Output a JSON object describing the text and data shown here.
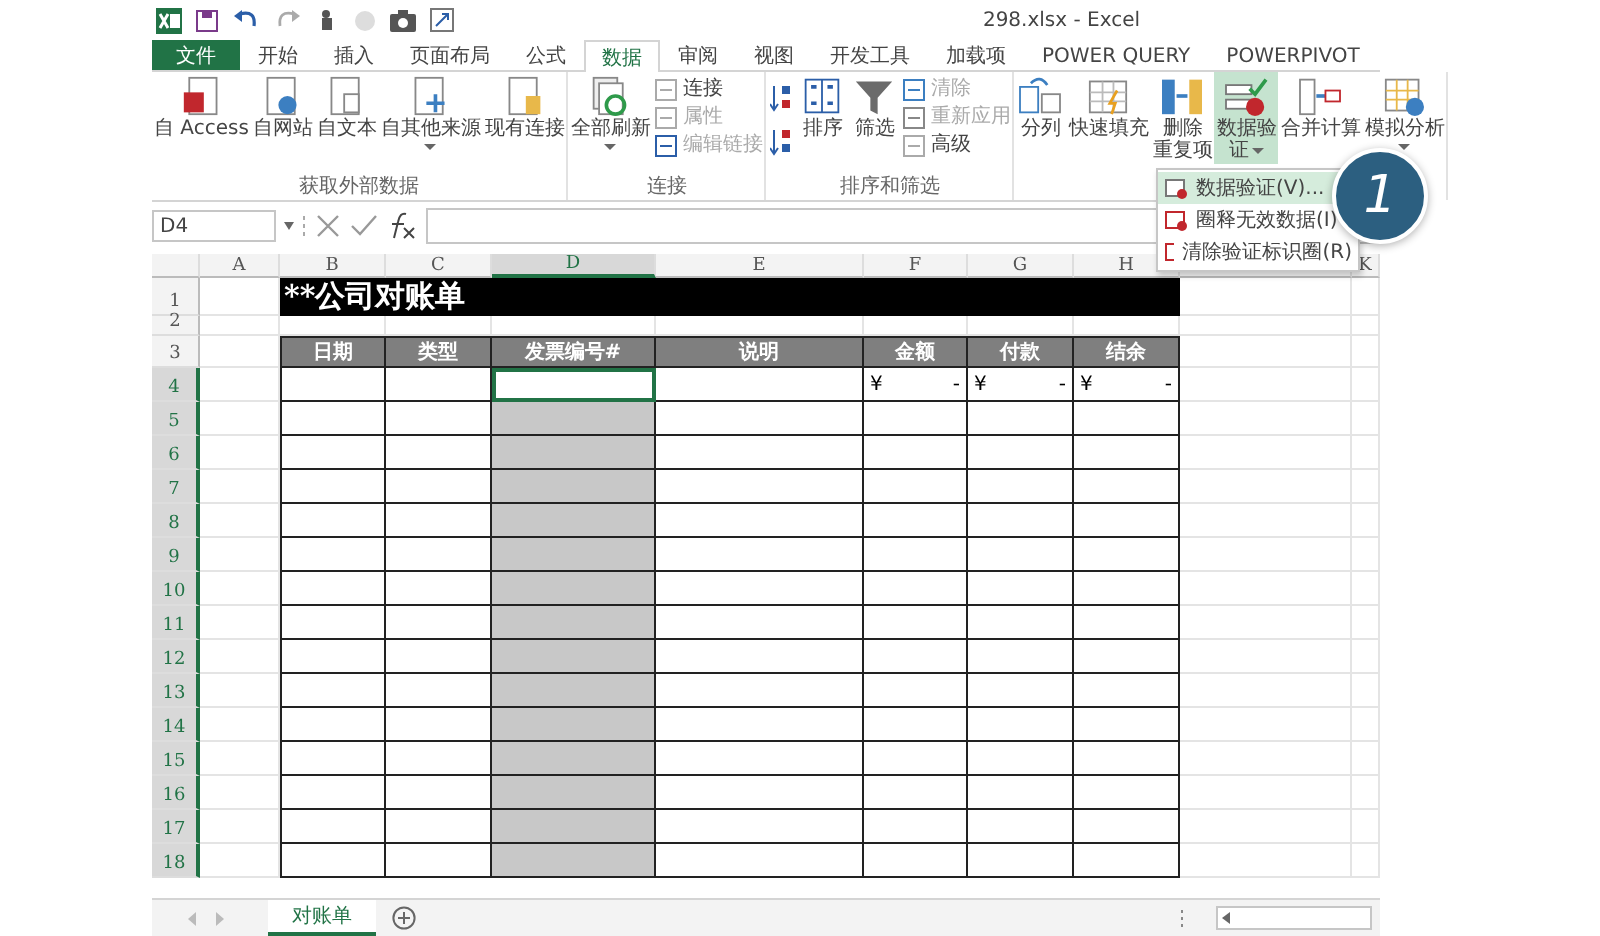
{
  "window": {
    "title": "298.xlsx - Excel"
  },
  "ribbon_tabs": [
    {
      "label": "文件",
      "kind": "file",
      "selected": false
    },
    {
      "label": "开始",
      "kind": "tab",
      "selected": false
    },
    {
      "label": "插入",
      "kind": "tab",
      "selected": false
    },
    {
      "label": "页面布局",
      "kind": "tab",
      "selected": false
    },
    {
      "label": "公式",
      "kind": "tab",
      "selected": false
    },
    {
      "label": "数据",
      "kind": "tab",
      "selected": true
    },
    {
      "label": "审阅",
      "kind": "tab",
      "selected": false
    },
    {
      "label": "视图",
      "kind": "tab",
      "selected": false
    },
    {
      "label": "开发工具",
      "kind": "tab",
      "selected": false
    },
    {
      "label": "加载项",
      "kind": "tab",
      "selected": false
    },
    {
      "label": "POWER QUERY",
      "kind": "tab",
      "selected": false
    },
    {
      "label": "POWERPIVOT",
      "kind": "tab",
      "selected": false
    }
  ],
  "ribbon_groups": [
    {
      "label": "获取外部数据",
      "items": [
        {
          "kind": "large",
          "lines": [
            "自 Access"
          ],
          "dropdown": false,
          "selected": false
        },
        {
          "kind": "large",
          "lines": [
            "自网站"
          ],
          "dropdown": false,
          "selected": false
        },
        {
          "kind": "large",
          "lines": [
            "自文本"
          ],
          "dropdown": false,
          "selected": false
        },
        {
          "kind": "large",
          "lines": [
            "自其他来源"
          ],
          "dropdown": true,
          "selected": false
        },
        {
          "kind": "large",
          "lines": [
            "现有连接"
          ],
          "dropdown": false,
          "selected": false
        }
      ]
    },
    {
      "label": "连接",
      "items": [
        {
          "kind": "large",
          "lines": [
            "全部刷新"
          ],
          "dropdown": true,
          "selected": false
        },
        {
          "kind": "stack",
          "items": [
            {
              "label": "连接",
              "disabled": false
            },
            {
              "label": "属性",
              "disabled": true
            },
            {
              "label": "编辑链接",
              "disabled": true
            }
          ]
        }
      ]
    },
    {
      "label": "排序和筛选",
      "items": [
        {
          "kind": "sort_pair"
        },
        {
          "kind": "large",
          "lines": [
            "排序"
          ],
          "dropdown": false,
          "selected": false
        },
        {
          "kind": "large",
          "lines": [
            "筛选"
          ],
          "dropdown": false,
          "selected": false
        },
        {
          "kind": "stack",
          "items": [
            {
              "label": "清除",
              "disabled": true
            },
            {
              "label": "重新应用",
              "disabled": true
            },
            {
              "label": "高级",
              "disabled": false
            }
          ]
        }
      ]
    },
    {
      "items": [
        {
          "kind": "large",
          "lines": [
            "分列"
          ],
          "dropdown": false,
          "selected": false
        },
        {
          "kind": "large",
          "lines": [
            "快速填充"
          ],
          "dropdown": false,
          "selected": false
        },
        {
          "kind": "large",
          "lines": [
            "删除",
            "重复项"
          ],
          "dropdown": false,
          "selected": false
        },
        {
          "kind": "large",
          "lines": [
            "数据验",
            "证"
          ],
          "dropdown": true,
          "selected": true
        },
        {
          "kind": "large",
          "lines": [
            "合并计算"
          ],
          "dropdown": false,
          "selected": false
        },
        {
          "kind": "large",
          "lines": [
            "模拟分析"
          ],
          "dropdown": true,
          "selected": false
        }
      ]
    }
  ],
  "dropdown_menu": {
    "items": [
      {
        "label": "数据验证(V)...",
        "selected": true
      },
      {
        "label": "圈释无效数据(I)",
        "selected": false
      },
      {
        "label": "清除验证标识圈(R)",
        "selected": false
      }
    ]
  },
  "callout": {
    "label": "1"
  },
  "formula_bar": {
    "name_box": "D4"
  },
  "columns": [
    {
      "label": "A",
      "selected": false
    },
    {
      "label": "B",
      "selected": false
    },
    {
      "label": "C",
      "selected": false
    },
    {
      "label": "D",
      "selected": true
    },
    {
      "label": "E",
      "selected": false
    },
    {
      "label": "F",
      "selected": false
    },
    {
      "label": "G",
      "selected": false
    },
    {
      "label": "H",
      "selected": false
    },
    {
      "label": "K",
      "selected": false
    }
  ],
  "sheet": {
    "title": "**公司对账单",
    "headers": [
      "日期",
      "类型",
      "发票编号#",
      "说明",
      "金额",
      "付款",
      "结余"
    ]
  },
  "rows": [
    {
      "number": "1",
      "kind": "title",
      "selected": false
    },
    {
      "number": "2",
      "kind": "blank",
      "selected": false
    },
    {
      "number": "3",
      "kind": "header",
      "selected": false
    },
    {
      "number": "4",
      "kind": "data",
      "selected": true,
      "active": true,
      "amounts": [
        {
          "symbol": "¥",
          "value": "-"
        },
        {
          "symbol": "¥",
          "value": "-"
        },
        {
          "symbol": "¥",
          "value": "-"
        }
      ]
    },
    {
      "number": "5",
      "kind": "data",
      "selected": true,
      "active": false
    },
    {
      "number": "6",
      "kind": "data",
      "selected": true,
      "active": false
    },
    {
      "number": "7",
      "kind": "data",
      "selected": true,
      "active": false
    },
    {
      "number": "8",
      "kind": "data",
      "selected": true,
      "active": false
    },
    {
      "number": "9",
      "kind": "data",
      "selected": true,
      "active": false
    },
    {
      "number": "10",
      "kind": "data",
      "selected": true,
      "active": false
    },
    {
      "number": "11",
      "kind": "data",
      "selected": true,
      "active": false
    },
    {
      "number": "12",
      "kind": "data",
      "selected": true,
      "active": false
    },
    {
      "number": "13",
      "kind": "data",
      "selected": true,
      "active": false
    },
    {
      "number": "14",
      "kind": "data",
      "selected": true,
      "active": false
    },
    {
      "number": "15",
      "kind": "data",
      "selected": true,
      "active": false
    },
    {
      "number": "16",
      "kind": "data",
      "selected": true,
      "active": false
    },
    {
      "number": "17",
      "kind": "data",
      "selected": true,
      "active": false
    },
    {
      "number": "18",
      "kind": "data",
      "selected": true,
      "active": false
    }
  ],
  "sheet_tabs": [
    {
      "label": "对账单",
      "selected": true
    }
  ]
}
